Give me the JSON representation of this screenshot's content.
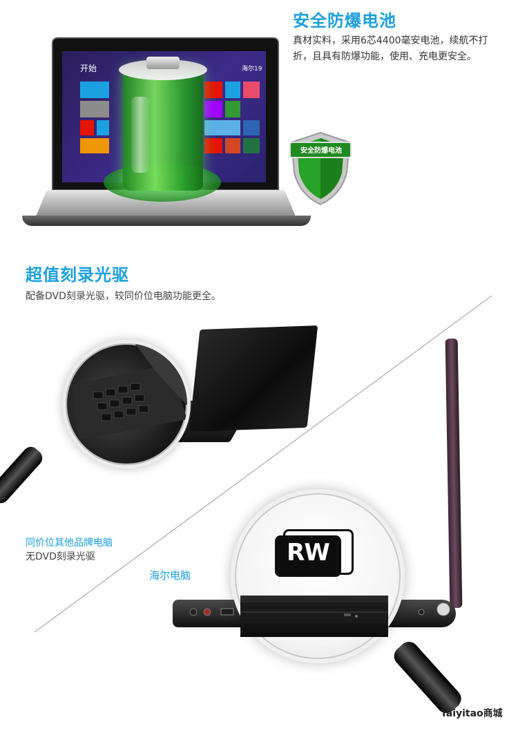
{
  "section1": {
    "title": "安全防爆电池",
    "description": "真材实料，采用6芯4400毫安电池，续航不打折，且具有防爆功能，使用、充电更安全。",
    "shield_label": "安全防爆电池",
    "screen_start": "开始",
    "screen_user": "海尔19"
  },
  "section2": {
    "title": "超值刻录光驱",
    "description": "配备DVD刻录光驱，较同价位电脑功能更全。",
    "caption_blue": "同价位其他品牌电脑",
    "caption_gray": "无DVD刻录光驱",
    "brand_label": "海尔电脑",
    "rw_badge": "RW"
  },
  "watermark": "Taiyitao商城",
  "colors": {
    "accent_blue": "#1aa0dc",
    "battery_green": "#4cc94c",
    "shield_green": "#27a327"
  }
}
